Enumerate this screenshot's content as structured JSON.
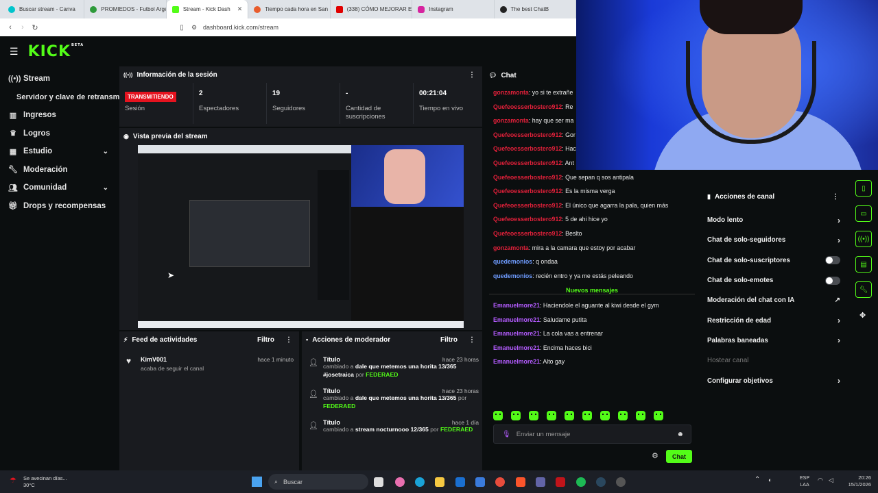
{
  "browser": {
    "tabs": [
      {
        "title": "Buscar stream - Canva",
        "color": "#00c4cc"
      },
      {
        "title": "PROMIEDOS - Futbol Arge",
        "color": "#2e9a3a"
      },
      {
        "title": "Stream - Kick Dash",
        "color": "#53fc18"
      },
      {
        "title": "Tiempo cada hora en San",
        "color": "#e85c2c"
      },
      {
        "title": "(338) CÓMO MEJORAR EL",
        "color": "#e00000"
      },
      {
        "title": "Instagram",
        "color": "#d6249f"
      },
      {
        "title": "The best ChatB",
        "color": "#222222"
      }
    ],
    "url": "dashboard.kick.com/stream"
  },
  "logo": {
    "text": "KICK",
    "tag": "BETA"
  },
  "sidebar": {
    "items": [
      {
        "label": "Stream",
        "icon": "broadcast-icon"
      },
      {
        "label": "Servidor y clave de retransm",
        "icon": ""
      },
      {
        "label": "Ingresos",
        "icon": "chart-icon"
      },
      {
        "label": "Logros",
        "icon": "trophy-icon"
      },
      {
        "label": "Estudio",
        "icon": "studio-icon"
      },
      {
        "label": "Moderación",
        "icon": "wrench-icon"
      },
      {
        "label": "Comunidad",
        "icon": "people-icon"
      },
      {
        "label": "Drops y recompensas",
        "icon": "gift-icon"
      }
    ]
  },
  "session": {
    "title": "Información de la sesión",
    "status": "TRANSMITIENDO",
    "status_label": "Sesión",
    "stats": [
      {
        "value": "2",
        "label": "Espectadores"
      },
      {
        "value": "19",
        "label": "Seguidores"
      },
      {
        "value": "-",
        "label": "Cantidad de suscripciones"
      },
      {
        "value": "00:21:04",
        "label": "Tiempo en vivo"
      }
    ]
  },
  "preview": {
    "title": "Vista previa del stream"
  },
  "feed": {
    "title": "Feed de actividades",
    "filter": "Filtro",
    "items": [
      {
        "user": "KimV001",
        "action": "acaba de seguir el canal",
        "time": "hace 1 minuto"
      }
    ]
  },
  "moderator": {
    "title": "Acciones de moderador",
    "filter": "Filtro",
    "items": [
      {
        "title": "Título",
        "prefix": "cambiado a",
        "value": "dale que metemos una horita 13/365 #josetraica",
        "by": "por",
        "user": "FEDERAED",
        "time": "hace 23 horas"
      },
      {
        "title": "Título",
        "prefix": "cambiado a",
        "value": "dale que metemos una horita 13/365",
        "by": "por",
        "user": "FEDERAED",
        "time": "hace 23 horas"
      },
      {
        "title": "Título",
        "prefix": "cambiado a",
        "value": "stream nocturnooo 12/365",
        "by": "por",
        "user": "FEDERAED",
        "time": "hace 1 día"
      }
    ]
  },
  "chat": {
    "title": "Chat",
    "messages": [
      {
        "user": "gonzamonta",
        "text": "yo si te extrañe",
        "color": "#e2203a"
      },
      {
        "user": "Quefeoesserbostero912",
        "text": "Re",
        "color": "#e2203a"
      },
      {
        "user": "gonzamonta",
        "text": "hay que ser ma",
        "color": "#e2203a"
      },
      {
        "user": "Quefeoesserbostero912",
        "text": "Gor",
        "color": "#e2203a"
      },
      {
        "user": "Quefeoesserbostero912",
        "text": "Hac",
        "color": "#e2203a"
      },
      {
        "user": "Quefeoesserbostero912",
        "text": "Ant",
        "color": "#e2203a"
      },
      {
        "user": "Quefeoesserbostero912",
        "text": "Que sepan q sos antipala",
        "color": "#e2203a"
      },
      {
        "user": "Quefeoesserbostero912",
        "text": "Es la misma verga",
        "color": "#e2203a"
      },
      {
        "user": "Quefeoesserbostero912",
        "text": "El único que agarra la pala, quien más",
        "color": "#e2203a"
      },
      {
        "user": "Quefeoesserbostero912",
        "text": "5 de ahi hice yo",
        "color": "#e2203a"
      },
      {
        "user": "Quefeoesserbostero912",
        "text": "Beslto",
        "color": "#e2203a"
      },
      {
        "user": "gonzamonta",
        "text": "mira a la camara que estoy por acabar",
        "color": "#e2203a"
      },
      {
        "user": "quedemonios",
        "text": "q ondaa",
        "color": "#6f9cff"
      },
      {
        "user": "quedemonios",
        "text": "recién entro y ya me estás peleando",
        "color": "#6f9cff"
      }
    ],
    "new_label": "Nuevos mensajes",
    "new_messages": [
      {
        "user": "Emanuelmore21",
        "text": "Haciendole el aguante al kiwi desde el gym",
        "color": "#b45cff"
      },
      {
        "user": "Emanuelmore21",
        "text": "Saludame putita",
        "color": "#b45cff"
      },
      {
        "user": "Emanuelmore21",
        "text": "La cola vas a entrenar",
        "color": "#b45cff"
      },
      {
        "user": "Emanuelmore21",
        "text": "Encima haces bici",
        "color": "#b45cff"
      },
      {
        "user": "Emanuelmore21",
        "text": "Alto gay",
        "color": "#b45cff"
      }
    ],
    "placeholder": "Enviar un mensaje",
    "send": "Chat"
  },
  "channel_actions": {
    "title": "Acciones de canal",
    "items": [
      {
        "label": "Modo lento",
        "control": "arrow"
      },
      {
        "label": "Chat de solo-seguidores",
        "control": "arrow"
      },
      {
        "label": "Chat de solo-suscriptores",
        "control": "toggle"
      },
      {
        "label": "Chat de solo-emotes",
        "control": "toggle"
      },
      {
        "label": "Moderación del chat con IA",
        "control": "external"
      },
      {
        "label": "Restricción de edad",
        "control": "arrow"
      },
      {
        "label": "Palabras baneadas",
        "control": "arrow"
      },
      {
        "label": "Hostear canal",
        "control": "none"
      },
      {
        "label": "Configurar objetivos",
        "control": "arrow"
      }
    ]
  },
  "taskbar": {
    "weather_line1": "Se avecinan días...",
    "weather_line2": "30°C",
    "search": "Buscar",
    "lang1": "ESP",
    "lang2": "LAA",
    "time": "20:26",
    "date": "15/1/2026"
  },
  "colors": {
    "accent": "#53fc18",
    "live": "#e5131f",
    "bg": "#0b0e0f",
    "panel": "#191b1f"
  }
}
